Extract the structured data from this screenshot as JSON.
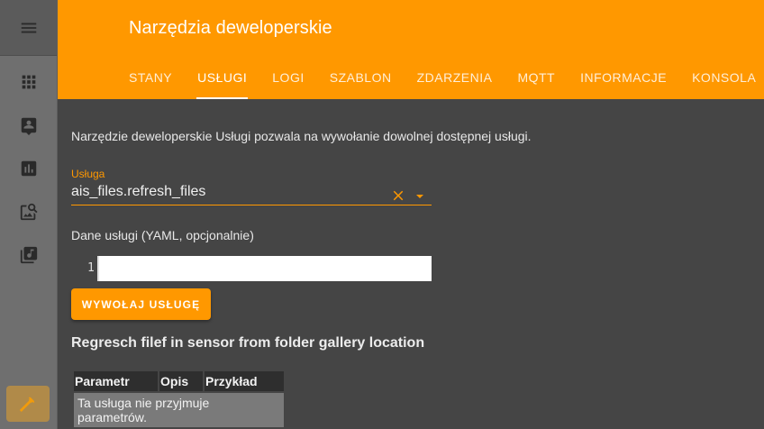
{
  "header": {
    "title": "Narzędzia deweloperskie",
    "tabs": [
      {
        "label": "STANY",
        "active": false
      },
      {
        "label": "USŁUGI",
        "active": true
      },
      {
        "label": "LOGI",
        "active": false
      },
      {
        "label": "SZABLON",
        "active": false
      },
      {
        "label": "ZDARZENIA",
        "active": false
      },
      {
        "label": "MQTT",
        "active": false
      },
      {
        "label": "INFORMACJE",
        "active": false
      },
      {
        "label": "KONSOLA",
        "active": false
      }
    ],
    "accent_color": "#ff9800"
  },
  "sidebar": {
    "items": [
      {
        "icon": "menu-icon"
      },
      {
        "icon": "apps-grid-icon"
      },
      {
        "icon": "account-box-icon"
      },
      {
        "icon": "chart-icon"
      },
      {
        "icon": "image-search-icon"
      },
      {
        "icon": "music-library-icon"
      },
      {
        "icon": "hammer-icon",
        "active": true
      }
    ]
  },
  "main": {
    "intro": "Narzędzie deweloperskie Usługi pozwala na wywołanie dowolnej dostępnej usługi.",
    "service_field": {
      "label": "Usługa",
      "value": "ais_files.refresh_files"
    },
    "data_label": "Dane usługi (YAML, opcjonalnie)",
    "code_editor": {
      "line_number": "1",
      "value": ""
    },
    "call_button": "WYWOŁAJ USŁUGĘ",
    "service_description": "Regresch filef in sensor from folder gallery location",
    "params_table": {
      "headers": [
        "Parametr",
        "Opis",
        "Przykład"
      ],
      "empty_message": "Ta usługa nie przyjmuje parametrów."
    }
  }
}
